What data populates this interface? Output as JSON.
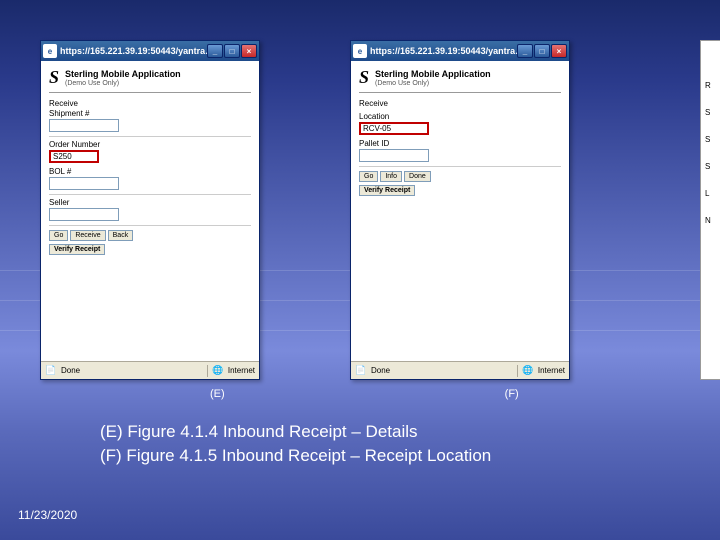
{
  "windows": {
    "e": {
      "title": "https://165.221.39.19:50443/yantra…",
      "app_title": "Sterling Mobile Application",
      "app_subtitle": "(Demo Use Only)",
      "fields": {
        "receive": "Receive",
        "shipment_label": "Shipment #",
        "shipment_value": "",
        "order_label": "Order Number",
        "order_value": "S250",
        "bol_label": "BOL #",
        "bol_value": "",
        "seller_label": "Seller",
        "seller_value": ""
      },
      "buttons": {
        "go": "Go",
        "receive": "Receive",
        "back": "Back",
        "verify": "Verify Receipt"
      },
      "status": {
        "left": "Done",
        "zone": "Internet"
      }
    },
    "f": {
      "title": "https://165.221.39.19:50443/yantra…",
      "app_title": "Sterling Mobile Application",
      "app_subtitle": "(Demo Use Only)",
      "fields": {
        "receive": "Receive",
        "location_label": "Location",
        "location_value": "RCV-05",
        "pallet_label": "Pallet ID",
        "pallet_value": ""
      },
      "buttons": {
        "go": "Go",
        "info": "Info",
        "done": "Done",
        "verify": "Verify Receipt"
      },
      "status": {
        "left": "Done",
        "zone": "Internet"
      }
    }
  },
  "edge_letters": [
    "R",
    "S",
    "S",
    "S",
    "L",
    "N"
  ],
  "labels": {
    "e": "(E)",
    "f": "(F)"
  },
  "captions": {
    "line1": "(E) Figure 4.1.4 Inbound Receipt – Details",
    "line2": "(F) Figure 4.1.5 Inbound Receipt – Receipt Location"
  },
  "footer_date": "11/23/2020"
}
